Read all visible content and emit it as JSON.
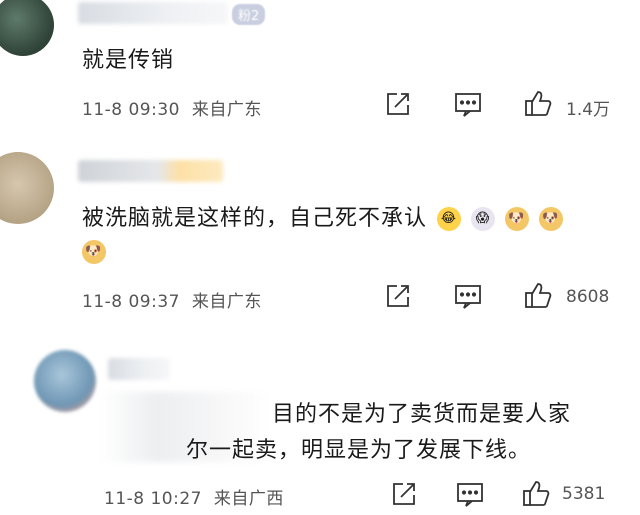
{
  "comments": [
    {
      "badge": "粉2",
      "text": "就是传销",
      "time": "11-8 09:30",
      "location": "来自广东",
      "likes": "1.4万"
    },
    {
      "text": "被洗脑就是这样的，自己死不承认",
      "time": "11-8 09:37",
      "location": "来自广东",
      "likes": "8608"
    },
    {
      "text_line1": "目的不是为了卖货而是要人家",
      "text_line2": "尔一起卖，明显是为了发展下线。",
      "time": "11-8 10:27",
      "location": "来自广西",
      "likes": "5381"
    }
  ],
  "icons": {
    "share": "share-icon",
    "comment": "comment-icon",
    "like": "like-icon"
  }
}
